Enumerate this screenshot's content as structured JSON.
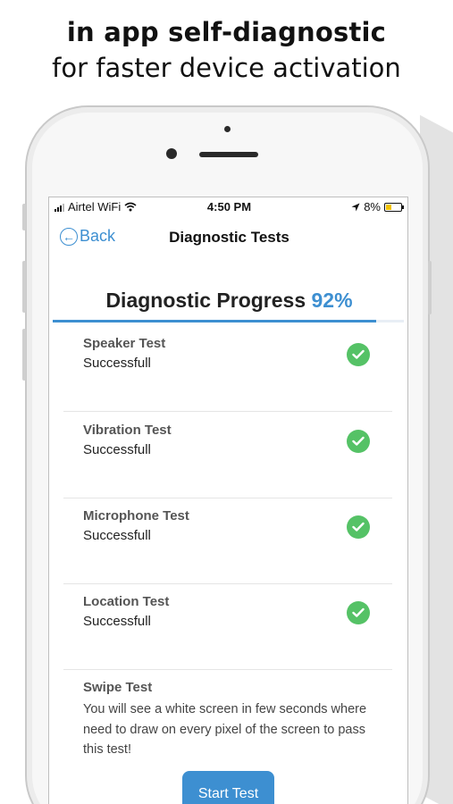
{
  "headline": {
    "line1": "in app self-diagnostic",
    "line2": "for faster device activation"
  },
  "status_bar": {
    "carrier": "Airtel WiFi",
    "time": "4:50 PM",
    "battery": "8%"
  },
  "nav": {
    "back_label": "Back",
    "title": "Diagnostic Tests"
  },
  "progress": {
    "label": "Diagnostic Progress",
    "percent_text": "92%",
    "value": 0.92
  },
  "tests": [
    {
      "name": "Speaker Test",
      "status": "Successfull"
    },
    {
      "name": "Vibration Test",
      "status": "Successfull"
    },
    {
      "name": "Microphone Test",
      "status": "Successfull"
    },
    {
      "name": "Location Test",
      "status": "Successfull"
    }
  ],
  "swipe_test": {
    "name": "Swipe Test",
    "description": "You will see a white screen in few seconds where need to draw on every pixel of the screen to pass this test!",
    "button_label": "Start Test"
  },
  "colors": {
    "accent": "#3d8fd1",
    "success": "#55c266"
  },
  "icons": [
    "wifi-icon",
    "signal-icon",
    "location-arrow-icon",
    "battery-icon",
    "back-arrow-icon",
    "check-icon"
  ]
}
